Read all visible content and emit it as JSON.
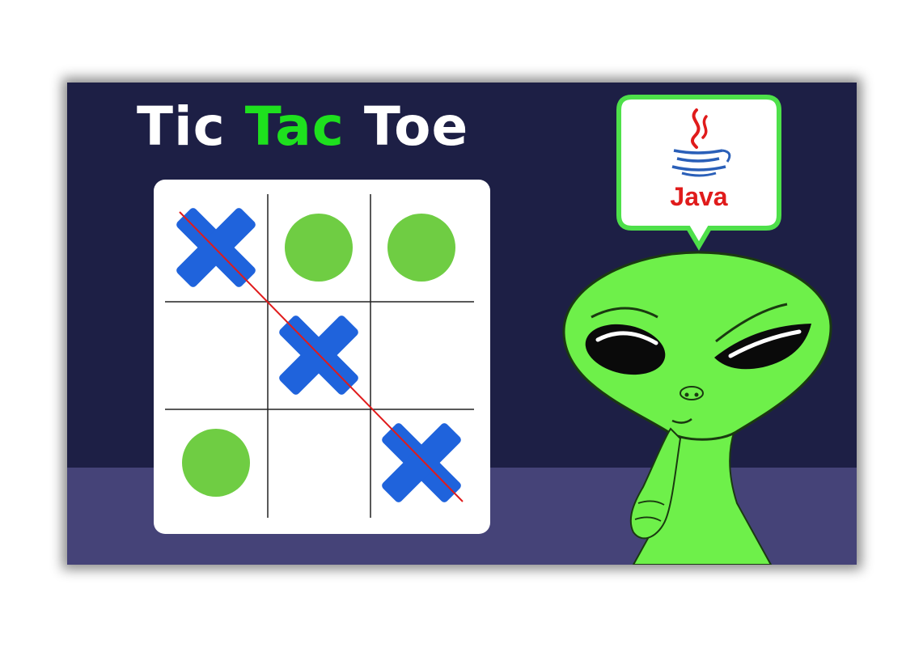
{
  "title": {
    "part1": "Tic ",
    "part2": "Tac",
    "part3": " Toe"
  },
  "colors": {
    "background": "#1d1f45",
    "floor": "#454378",
    "accent_green": "#1ee01e",
    "x_mark": "#1f63dc",
    "o_mark": "#6fcd43",
    "win_line": "#e01b1b",
    "alien": "#6ef04a"
  },
  "board": {
    "cells": [
      [
        "X",
        "O",
        "O"
      ],
      [
        "",
        "X",
        ""
      ],
      [
        "O",
        "",
        "X"
      ]
    ],
    "winning_line": "diagonal"
  },
  "speech_bubble": {
    "logo_icon": "java-logo-icon",
    "label": "Java"
  },
  "character": "alien-thinking"
}
